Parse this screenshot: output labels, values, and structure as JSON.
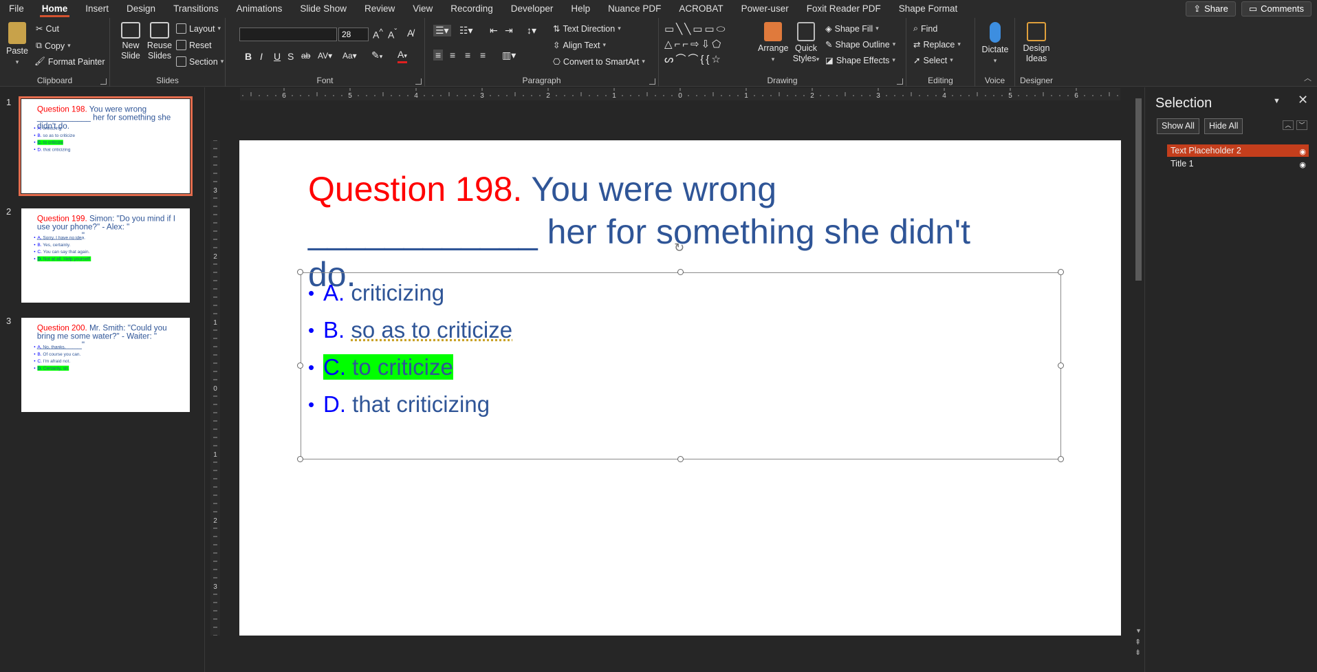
{
  "menu": {
    "tabs": [
      "File",
      "Home",
      "Insert",
      "Design",
      "Transitions",
      "Animations",
      "Slide Show",
      "Review",
      "View",
      "Recording",
      "Developer",
      "Help",
      "Nuance PDF",
      "ACROBAT",
      "Power-user",
      "Foxit Reader PDF",
      "Shape Format"
    ],
    "active": "Home",
    "share": "Share",
    "comments": "Comments"
  },
  "ribbon": {
    "clipboard": {
      "label": "Clipboard",
      "paste": "Paste",
      "cut": "Cut",
      "copy": "Copy",
      "format_painter": "Format Painter"
    },
    "slides": {
      "label": "Slides",
      "new_slide": "New Slide",
      "reuse_slides": "Reuse Slides",
      "layout": "Layout",
      "reset": "Reset",
      "section": "Section"
    },
    "font": {
      "label": "Font",
      "font_name": "",
      "font_size": "28"
    },
    "paragraph": {
      "label": "Paragraph",
      "text_direction": "Text Direction",
      "align_text": "Align Text",
      "convert_smartart": "Convert to SmartArt"
    },
    "drawing": {
      "label": "Drawing",
      "arrange": "Arrange",
      "quick_styles": "Quick Styles",
      "shape_fill": "Shape Fill",
      "shape_outline": "Shape Outline",
      "shape_effects": "Shape Effects"
    },
    "editing": {
      "label": "Editing",
      "find": "Find",
      "replace": "Replace",
      "select": "Select"
    },
    "voice": {
      "label": "Voice",
      "dictate": "Dictate"
    },
    "designer": {
      "label": "Designer",
      "design_ideas": "Design Ideas"
    }
  },
  "slides": [
    {
      "number": "1",
      "q_label": "Question 198.",
      "q_text": " You were wrong ____________ her for something she didn't do.",
      "options": [
        {
          "letter": "A.",
          "text": "criticizing",
          "highlight": false
        },
        {
          "letter": "B.",
          "text": "so as to criticize",
          "highlight": false
        },
        {
          "letter": "C.",
          "text": "to criticize",
          "highlight": true
        },
        {
          "letter": "D.",
          "text": "that criticizing",
          "highlight": false
        }
      ]
    },
    {
      "number": "2",
      "q_label": "Question 199.",
      "q_text": " Simon: \"Do you mind if I use your phone?\" - Alex: \" __________\"",
      "options": [
        {
          "letter": "A.",
          "text": "Sorry. I have no idea.",
          "highlight": false
        },
        {
          "letter": "B.",
          "text": "Yes, certainly.",
          "highlight": false
        },
        {
          "letter": "C.",
          "text": "You can say that again.",
          "highlight": false
        },
        {
          "letter": "D.",
          "text": "Not at all. Help yourself.",
          "highlight": true
        }
      ]
    },
    {
      "number": "3",
      "q_label": "Question 200.",
      "q_text": " Mr. Smith: \"Could you bring me some water?\" - Waiter: \" __________\"",
      "options": [
        {
          "letter": "A.",
          "text": "No, thanks.",
          "highlight": false
        },
        {
          "letter": "B.",
          "text": "Of course you can.",
          "highlight": false
        },
        {
          "letter": "C.",
          "text": "I'm afraid not.",
          "highlight": false
        },
        {
          "letter": "D.",
          "text": "Certainly, sir.",
          "highlight": true
        }
      ]
    }
  ],
  "selection_pane": {
    "title": "Selection",
    "show_all": "Show All",
    "hide_all": "Hide All",
    "items": [
      "Text Placeholder 2",
      "Title 1"
    ]
  },
  "colors": {
    "accent": "#d35230",
    "question_red": "#ff0000",
    "text_blue": "#2f5597",
    "letter_blue": "#0000ff",
    "highlight": "#00ff00"
  }
}
